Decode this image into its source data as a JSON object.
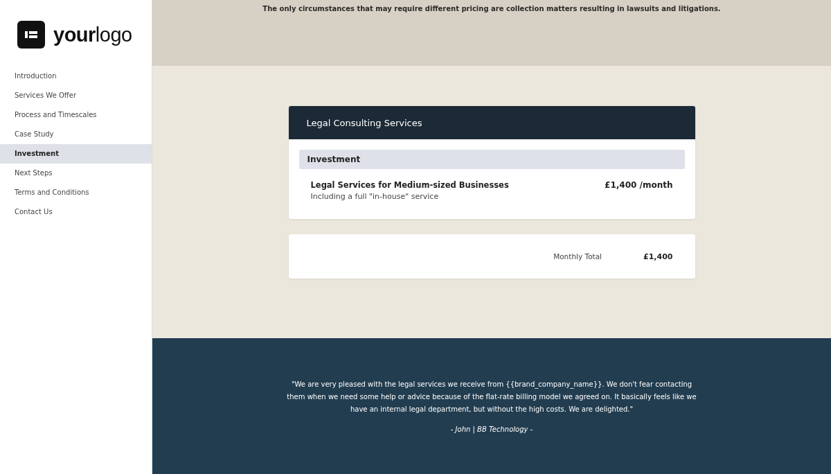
{
  "logo": {
    "text": "**your**logo"
  },
  "sidebar": {
    "items": [
      {
        "label": "Introduction",
        "selected": false
      },
      {
        "label": "Services We Offer",
        "selected": false
      },
      {
        "label": "Process and Timescales",
        "selected": false
      },
      {
        "label": "Case Study",
        "selected": false
      },
      {
        "label": "Investment",
        "selected": true
      },
      {
        "label": "Next Steps",
        "selected": false
      },
      {
        "label": "Terms and Conditions",
        "selected": false
      },
      {
        "label": "Contact Us",
        "selected": false
      }
    ]
  },
  "notice": "The only circumstances that may require different pricing are collection matters resulting in lawsuits and litigations.",
  "pricing_card": {
    "title": "Legal Consulting Services",
    "section": "Investment",
    "items": [
      {
        "name": "Legal Services for Medium-sized Businesses",
        "description": "Including a full \"in-house\" service",
        "price": "£1,400 /month"
      }
    ]
  },
  "total": {
    "label": "Monthly Total",
    "value": "£1,400"
  },
  "testimonial": {
    "quote": "\"We are very pleased with the legal services we receive from {{brand_company_name}}. We don't fear contacting them when we need some help or advice because of the flat-rate billing model we agreed on. It basically feels like we have an internal legal department, but without the high costs. We are delighted.\"",
    "author": "- John | BB Technology -"
  }
}
